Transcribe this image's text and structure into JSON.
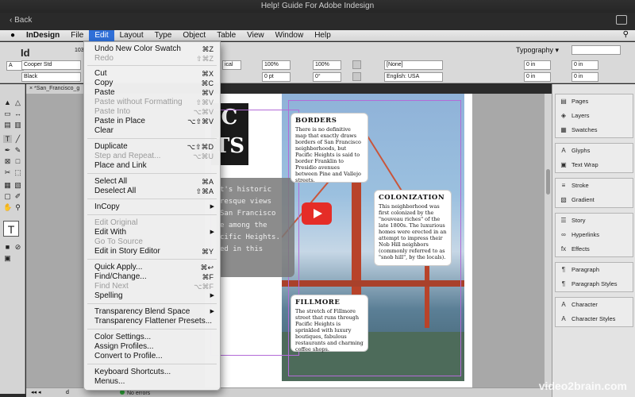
{
  "window": {
    "title": "Help! Guide For Adobe Indesign",
    "back_label": "Back"
  },
  "menubar": {
    "app": "InDesign",
    "items": [
      "File",
      "Edit",
      "Layout",
      "Type",
      "Object",
      "Table",
      "View",
      "Window",
      "Help"
    ],
    "active": "Edit"
  },
  "control": {
    "font": "Cooper Std",
    "style": "Black",
    "size_a": "100%",
    "size_b": "100%",
    "offset_a": "0 pt",
    "offset_b": "0°",
    "none_value": "[None]",
    "lang": "English: USA",
    "inset_a": "0 in",
    "inset_b": "0 in",
    "inset_c": "0 in",
    "inset_d": "0 in",
    "workspace": "Typography",
    "snippet_a": "ical",
    "snippet_b": "103"
  },
  "document": {
    "tab": "*San_Francisco_g",
    "status": "No errors",
    "page": "d"
  },
  "dropdown": {
    "items": [
      {
        "label": "Undo New Color Swatch",
        "shortcut": "⌘Z",
        "disabled": false
      },
      {
        "label": "Redo",
        "shortcut": "⇧⌘Z",
        "disabled": true
      },
      {
        "label": "Cut",
        "shortcut": "⌘X",
        "disabled": false
      },
      {
        "label": "Copy",
        "shortcut": "⌘C",
        "disabled": false
      },
      {
        "label": "Paste",
        "shortcut": "⌘V",
        "disabled": false
      },
      {
        "label": "Paste without Formatting",
        "shortcut": "⇧⌘V",
        "disabled": true
      },
      {
        "label": "Paste Into",
        "shortcut": "⌥⌘V",
        "disabled": true
      },
      {
        "label": "Paste in Place",
        "shortcut": "⌥⇧⌘V",
        "disabled": false
      },
      {
        "label": "Clear",
        "shortcut": "",
        "disabled": false
      },
      {
        "label": "Duplicate",
        "shortcut": "⌥⇧⌘D",
        "disabled": false
      },
      {
        "label": "Step and Repeat...",
        "shortcut": "⌥⌘U",
        "disabled": true
      },
      {
        "label": "Place and Link",
        "shortcut": "",
        "disabled": false
      },
      {
        "label": "Select All",
        "shortcut": "⌘A",
        "disabled": false
      },
      {
        "label": "Deselect All",
        "shortcut": "⇧⌘A",
        "disabled": false
      },
      {
        "label": "InCopy",
        "shortcut": "",
        "submenu": true,
        "disabled": false
      },
      {
        "label": "Edit Original",
        "shortcut": "",
        "disabled": true
      },
      {
        "label": "Edit With",
        "shortcut": "",
        "submenu": true,
        "disabled": false
      },
      {
        "label": "Go To Source",
        "shortcut": "",
        "disabled": true
      },
      {
        "label": "Edit in Story Editor",
        "shortcut": "⌘Y",
        "disabled": false
      },
      {
        "label": "Quick Apply...",
        "shortcut": "⌘↩",
        "disabled": false
      },
      {
        "label": "Find/Change...",
        "shortcut": "⌘F",
        "disabled": false
      },
      {
        "label": "Find Next",
        "shortcut": "⌥⌘F",
        "disabled": true
      },
      {
        "label": "Spelling",
        "shortcut": "",
        "submenu": true,
        "disabled": false
      },
      {
        "label": "Transparency Blend Space",
        "shortcut": "",
        "submenu": true,
        "disabled": false
      },
      {
        "label": "Transparency Flattener Presets...",
        "shortcut": "",
        "disabled": false
      },
      {
        "label": "Color Settings...",
        "shortcut": "",
        "disabled": false
      },
      {
        "label": "Assign Profiles...",
        "shortcut": "",
        "disabled": false
      },
      {
        "label": "Convert to Profile...",
        "shortcut": "",
        "disabled": false
      },
      {
        "label": "Keyboard Shortcuts...",
        "shortcut": "",
        "disabled": false
      },
      {
        "label": "Menus...",
        "shortcut": "",
        "disabled": false
      }
    ]
  },
  "panels": {
    "groups": [
      [
        "Pages",
        "Layers",
        "Swatches"
      ],
      [
        "Glyphs",
        "Text Wrap"
      ],
      [
        "Stroke",
        "Gradient"
      ],
      [
        "Story",
        "Hyperlinks",
        "Effects"
      ],
      [
        "Paragraph",
        "Paragraph Styles"
      ],
      [
        "Character",
        "Character Styles"
      ]
    ]
  },
  "layout": {
    "headline": "C\nTS",
    "overlay_text": "t's historic\nresque views\nSan Francisco\ne among the\ncific Heights.\ned in this",
    "cards": [
      {
        "title": "BORDERS",
        "body": "There is no definitive map that exactly draws borders of San Francisco neighborhoods, but Pacific Heights is said to border Franklin to Presidio avenues between Pine and Vallejo streets."
      },
      {
        "title": "COLONIZATION",
        "body": "This neighborhood was first colonized by the \"nouveau riches\" of the late 1800s. The luxurious homes were erected in an attempt to impress their Nob Hill neighbors (commonly referred to as \"snob hill\", by the locals)."
      },
      {
        "title": "FILLMORE",
        "body": "The stretch of Fillmore street that runs through Pacific Heights is sprinkled with luxury boutiques, fabulous restaurants and charming coffee shops."
      }
    ]
  },
  "watermark": "video2brain.com"
}
